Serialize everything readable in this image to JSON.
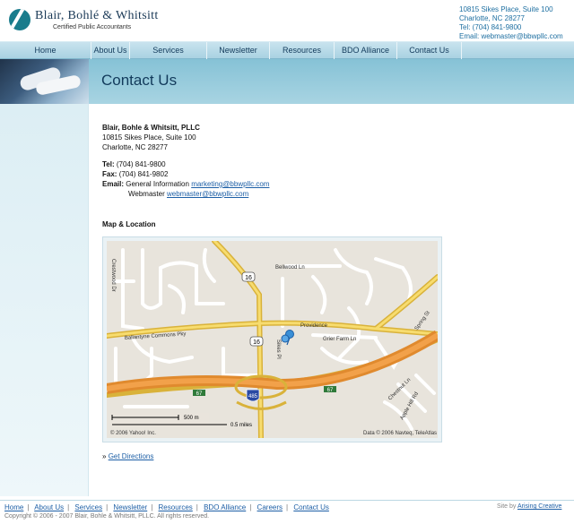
{
  "header": {
    "logo_name": "Blair, Bohlé & Whitsitt",
    "logo_sub": "Certified Public Accountants",
    "address1": "10815 Sikes Place, Suite 100",
    "address2": "Charlotte, NC 28277",
    "tel": "Tel: (704) 841-9800",
    "email": "Email: webmaster@bbwpllc.com"
  },
  "nav": [
    "Home",
    "About Us",
    "Services",
    "Newsletter",
    "Resources",
    "BDO Alliance",
    "Contact Us"
  ],
  "page_title": "Contact Us",
  "contact": {
    "firm_name": "Blair, Bohle & Whitsitt, PLLC",
    "address1": "10815 Sikes Place, Suite 100",
    "address2": "Charlotte, NC 28277",
    "tel_label": "Tel:",
    "tel": "(704) 841-9800",
    "fax_label": "Fax:",
    "fax": "(704) 841-9802",
    "email_label": "Email:",
    "general_label": "General Information",
    "general_email": "marketing@bbwpllc.com",
    "webmaster_label": "Webmaster",
    "webmaster_email": "webmaster@bbwpllc.com"
  },
  "map": {
    "heading": "Map & Location",
    "labels": {
      "crestwood": "Crestwood Dr",
      "bellwood": "Bellwood Ln",
      "route16_top": "16",
      "route16_mid": "16",
      "ballantyne": "Ballantyne Commons Pky",
      "providence": "Providence",
      "sikes": "Sikes Pl",
      "grier": "Grier Farm Ln",
      "spring": "Spring St",
      "shield_485": "485",
      "exit67_left": "67",
      "exit67_right": "67",
      "chestnut": "Chestnut Ln",
      "apple": "Apple Hill Rd",
      "scale_m": "500 m",
      "scale_mi": "0.5 miles",
      "copyright_left": "© 2006 Yahoo! Inc.",
      "copyright_right": "Data © 2006 Navteq, TeleAtlas"
    }
  },
  "directions": {
    "arrow": "»",
    "label": "Get Directions"
  },
  "footer": {
    "links": [
      "Home",
      "About Us",
      "Services",
      "Newsletter",
      "Resources",
      "BDO Alliance",
      "Careers",
      "Contact Us"
    ],
    "copyright": "Copyright © 2006 - 2007 Blair, Bohle & Whitsitt, PLLC. All rights reserved.",
    "credit_prefix": "Site by",
    "credit_link": "Arising Creative"
  },
  "colors": {
    "brand": "#1a7c8c",
    "nav_text": "#123a5b",
    "link": "#1d5fa6"
  }
}
